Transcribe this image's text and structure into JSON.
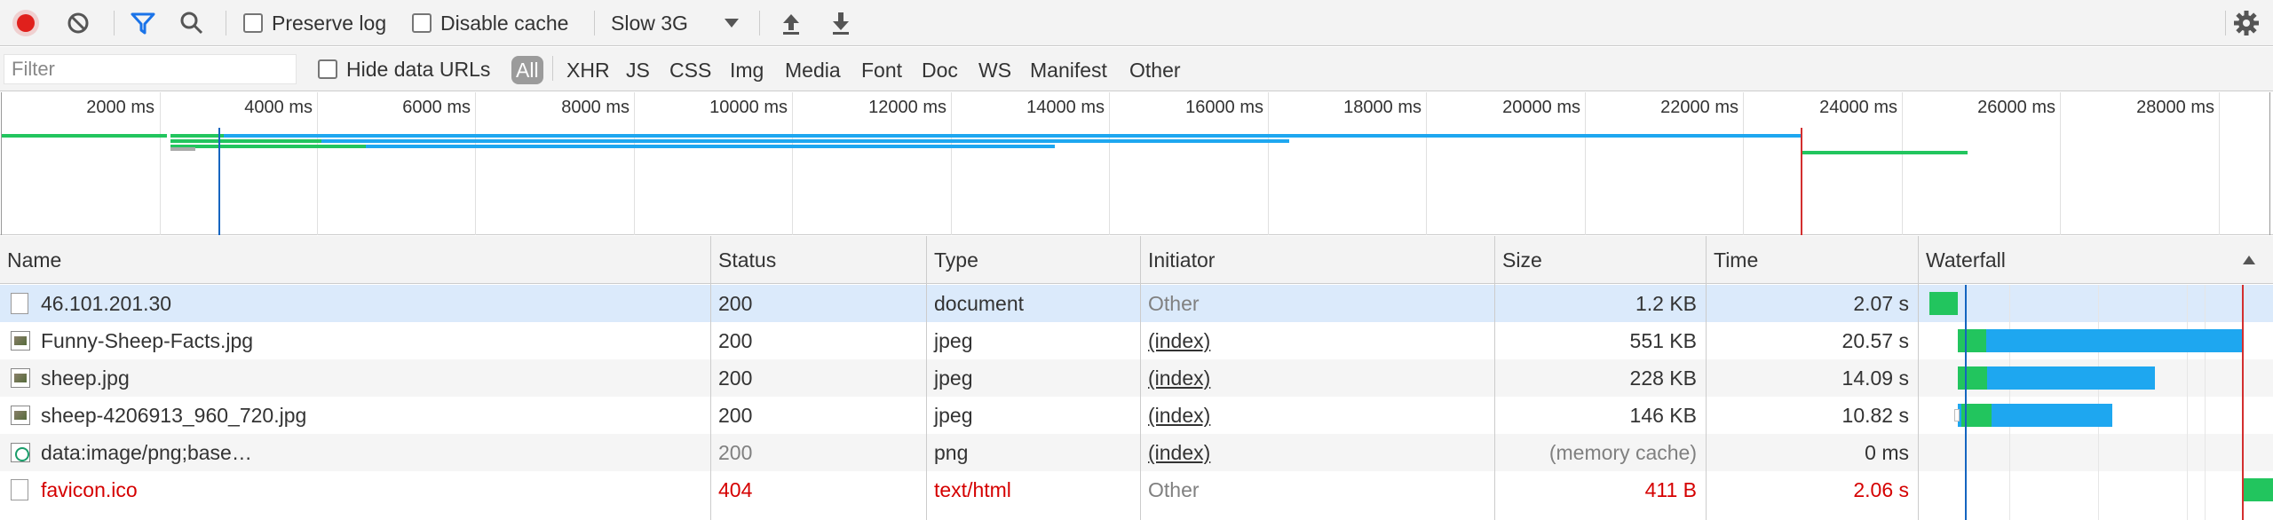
{
  "toolbar": {
    "record_icon": "record-icon",
    "clear_icon": "clear-icon",
    "filter_icon": "filter-icon",
    "search_icon": "search-icon",
    "preserve_log_label": "Preserve log",
    "disable_cache_label": "Disable cache",
    "throttle_value": "Slow 3G",
    "upload_icon": "import-har-icon",
    "download_icon": "export-har-icon",
    "settings_icon": "gear-icon",
    "record_color": "#e0201c",
    "filter_color": "#1a73e8"
  },
  "filterbar": {
    "placeholder": "Filter",
    "hide_data_urls_label": "Hide data URLs",
    "types": [
      "All",
      "XHR",
      "JS",
      "CSS",
      "Img",
      "Media",
      "Font",
      "Doc",
      "WS",
      "Manifest",
      "Other"
    ]
  },
  "overview": {
    "ticks": [
      "2000 ms",
      "4000 ms",
      "6000 ms",
      "8000 ms",
      "10000 ms",
      "12000 ms",
      "14000 ms",
      "16000 ms",
      "18000 ms",
      "20000 ms",
      "22000 ms",
      "24000 ms",
      "26000 ms",
      "28000 ms"
    ]
  },
  "table": {
    "columns": [
      "Name",
      "Status",
      "Type",
      "Initiator",
      "Size",
      "Time",
      "Waterfall"
    ],
    "sort_icon": "sort-up-icon",
    "rows": [
      {
        "name": "46.101.201.30",
        "status": "200",
        "type": "document",
        "initiator": "Other",
        "size": "1.2 KB",
        "time": "2.07 s",
        "icon": "document-icon"
      },
      {
        "name": "Funny-Sheep-Facts.jpg",
        "status": "200",
        "type": "jpeg",
        "initiator": "(index)",
        "size": "551 KB",
        "time": "20.57 s",
        "icon": "image-icon"
      },
      {
        "name": "sheep.jpg",
        "status": "200",
        "type": "jpeg",
        "initiator": "(index)",
        "size": "228 KB",
        "time": "14.09 s",
        "icon": "image-icon"
      },
      {
        "name": "sheep-4206913_960_720.jpg",
        "status": "200",
        "type": "jpeg",
        "initiator": "(index)",
        "size": "146 KB",
        "time": "10.82 s",
        "icon": "image-icon"
      },
      {
        "name": "data:image/png;base…",
        "status": "200",
        "type": "png",
        "initiator": "(index)",
        "size": "(memory cache)",
        "time": "0 ms",
        "icon": "data-url-icon"
      },
      {
        "name": "favicon.ico",
        "status": "404",
        "type": "text/html",
        "initiator": "Other",
        "size": "411 B",
        "time": "2.06 s",
        "icon": "document-icon"
      }
    ]
  },
  "colors": {
    "selected_row": "#dbeafb",
    "alt_row": "#f5f5f5",
    "error_text": "#d50000",
    "muted_text": "#808080",
    "waiting_green": "#22c55e",
    "download_blue": "#1ea7f0",
    "dom_line": "#1565c0",
    "load_line": "#d32f2f"
  }
}
